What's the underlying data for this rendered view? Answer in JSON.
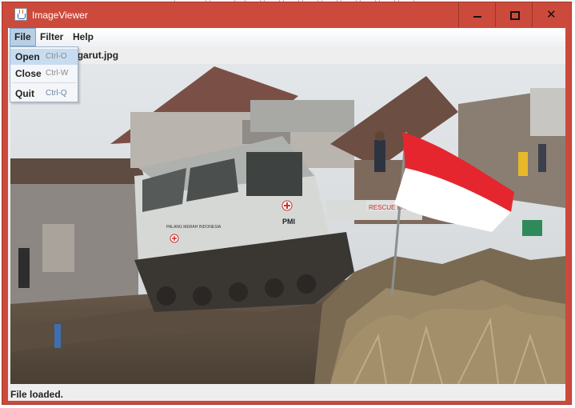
{
  "window": {
    "title": "ImageViewer",
    "controls": {
      "minimize": "minimize",
      "maximize": "maximize",
      "close": "close"
    },
    "accent_color": "#cc4a3c"
  },
  "menubar": {
    "items": [
      {
        "label": "File",
        "expanded": true
      },
      {
        "label": "Filter"
      },
      {
        "label": "Help"
      }
    ]
  },
  "file_menu": {
    "items": [
      {
        "label": "Open",
        "shortcut": "Ctrl-O",
        "highlighted": true
      },
      {
        "label": "Close",
        "shortcut": "Ctrl-W"
      },
      {
        "label": "Quit",
        "shortcut": "Ctrl-Q"
      }
    ]
  },
  "path_bar": {
    "text": "ser1\\Pictures\\garut.jpg"
  },
  "image": {
    "icon": "photo-icon",
    "flag_colors": [
      "#e5262e",
      "#ffffff"
    ]
  },
  "status_bar": {
    "text": "File loaded."
  },
  "icons": {
    "app": "java-cup-icon",
    "close": "close-icon",
    "minimize": "minimize-icon",
    "maximize": "maximize-icon"
  }
}
